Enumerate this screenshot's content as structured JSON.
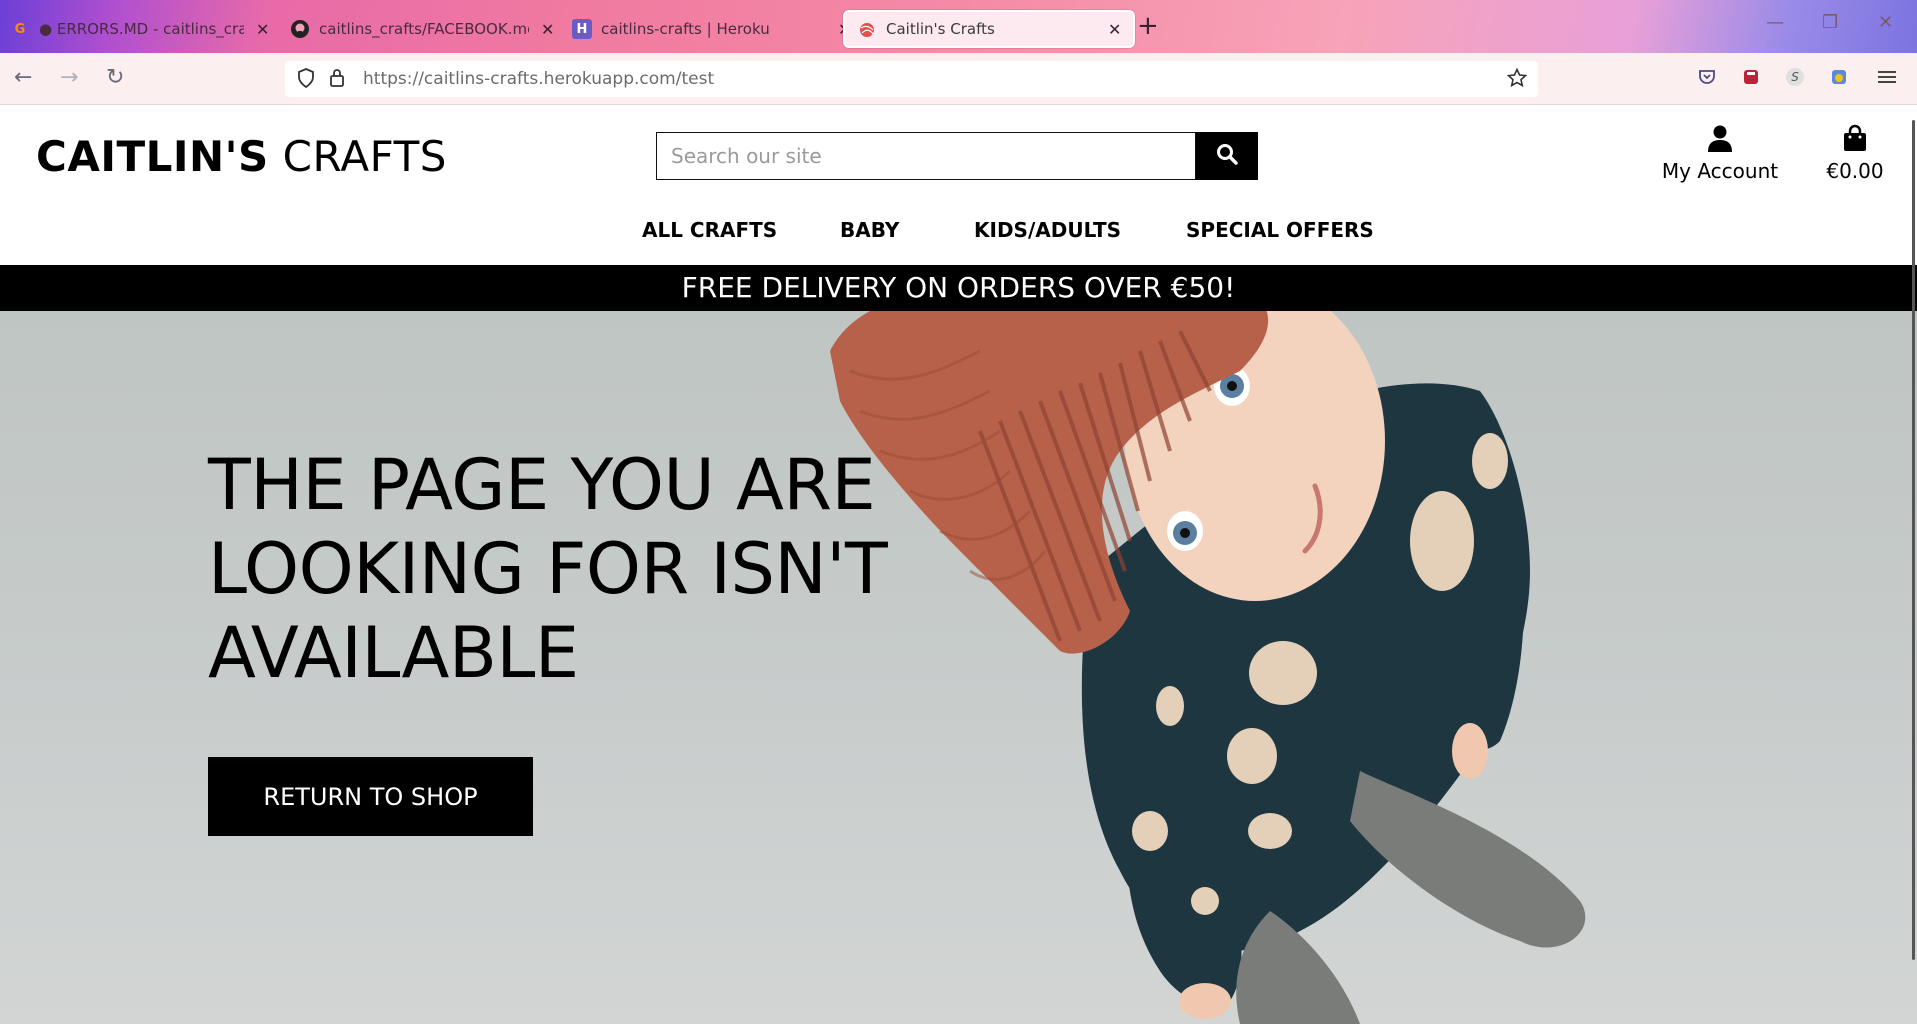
{
  "browser": {
    "tabs": [
      {
        "title": "● ERRORS.MD - caitlins_crafts -",
        "icon": "gitpod-icon"
      },
      {
        "title": "caitlins_crafts/FACEBOOK.md at",
        "icon": "github-icon"
      },
      {
        "title": "caitlins-crafts | Heroku",
        "icon": "heroku-icon"
      },
      {
        "title": "Caitlin's Crafts",
        "icon": "yarn-icon",
        "active": true
      }
    ],
    "url_host": "https://caitlins-crafts.herokuapp.com",
    "url_path": "/test"
  },
  "site": {
    "logo_bold": "CAITLIN'S",
    "logo_light": "CRAFTS",
    "search_placeholder": "Search our site",
    "account_label": "My Account",
    "cart_total": "€0.00",
    "nav": [
      "ALL CRAFTS",
      "BABY",
      "KIDS/ADULTS",
      "SPECIAL OFFERS"
    ],
    "promo": "FREE DELIVERY ON ORDERS OVER €50!"
  },
  "hero": {
    "title": "THE PAGE YOU ARE LOOKING FOR ISN'T AVAILABLE",
    "button": "RETURN TO SHOP"
  }
}
